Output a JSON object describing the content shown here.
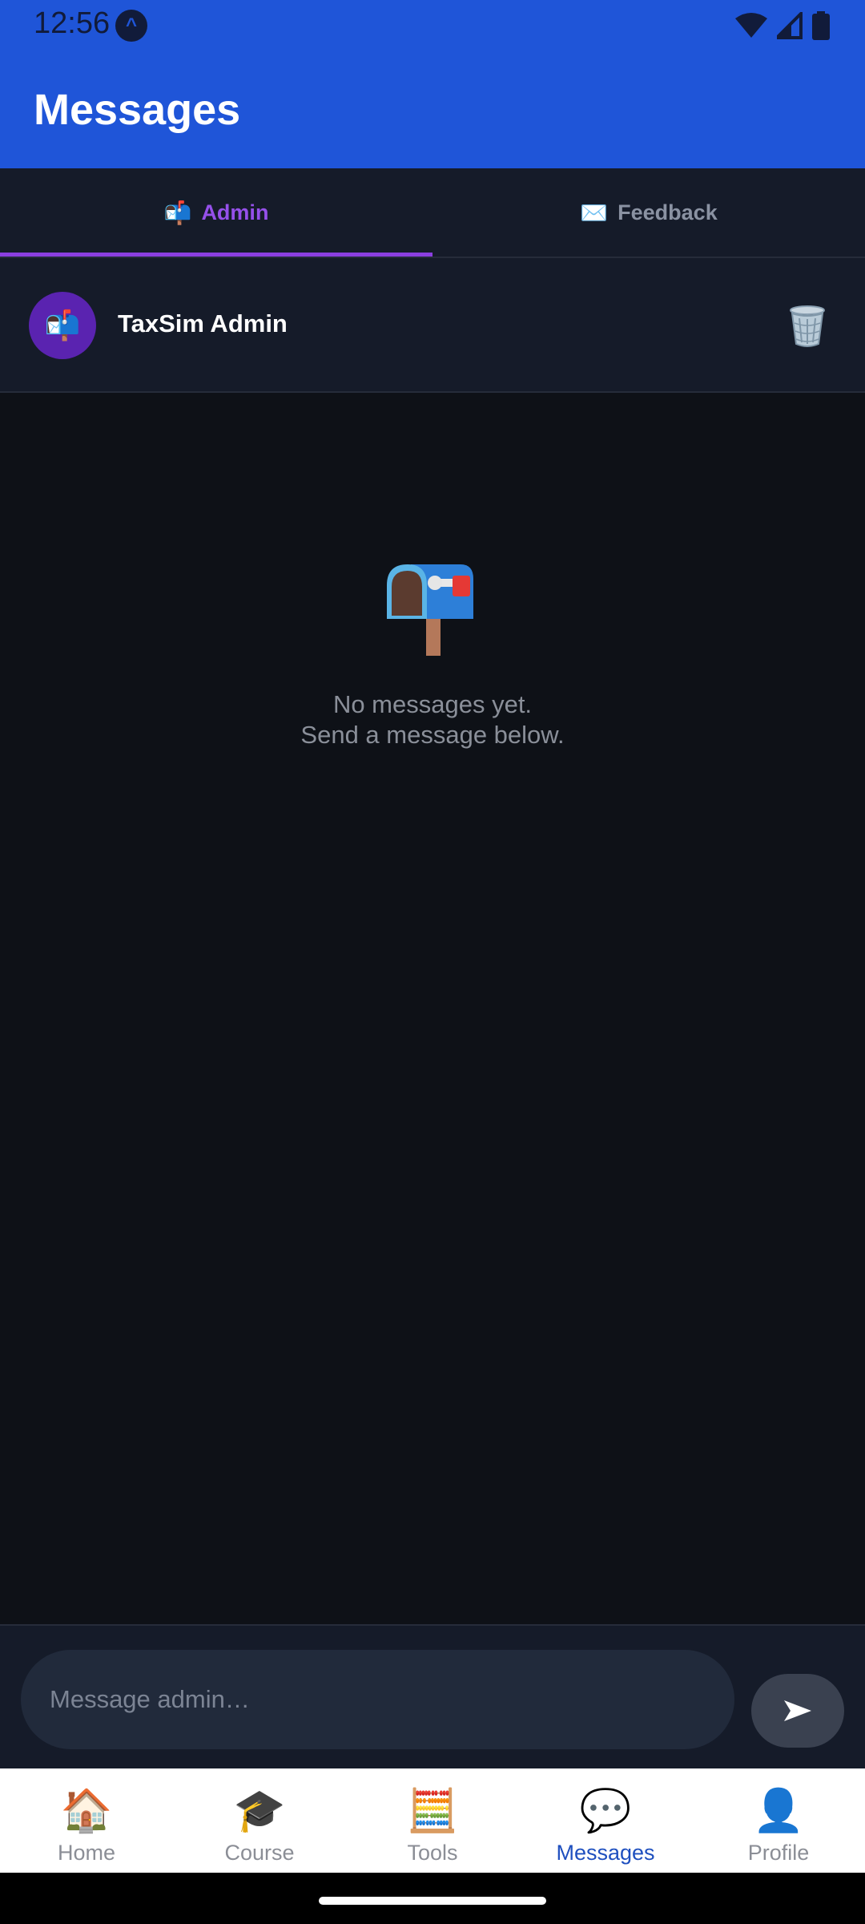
{
  "status_bar": {
    "time": "12:56"
  },
  "app_bar": {
    "title": "Messages"
  },
  "tabs": [
    {
      "icon": "📬",
      "label": "Admin",
      "active": true
    },
    {
      "icon": "✉️",
      "label": "Feedback",
      "active": false
    }
  ],
  "conversation": {
    "avatar_icon": "📬",
    "name": "TaxSim Admin",
    "delete_icon": "trash-icon"
  },
  "empty_state": {
    "icon": "mailbox-icon",
    "line1": "No messages yet.",
    "line2": "Send a message below."
  },
  "composer": {
    "placeholder": "Message admin…",
    "value": "",
    "send_icon": "send-arrow-icon"
  },
  "bottom_nav": [
    {
      "icon": "🏠",
      "label": "Home",
      "active": false
    },
    {
      "icon": "🎓",
      "label": "Course",
      "active": false
    },
    {
      "icon": "🧮",
      "label": "Tools",
      "active": false
    },
    {
      "icon": "💬",
      "label": "Messages",
      "active": true
    },
    {
      "icon": "👤",
      "label": "Profile",
      "active": false
    }
  ],
  "colors": {
    "app_bar": "#1f55d8",
    "tab_active": "#9550ea",
    "background": "#0e1117",
    "nav_active": "#1e4fbf"
  }
}
